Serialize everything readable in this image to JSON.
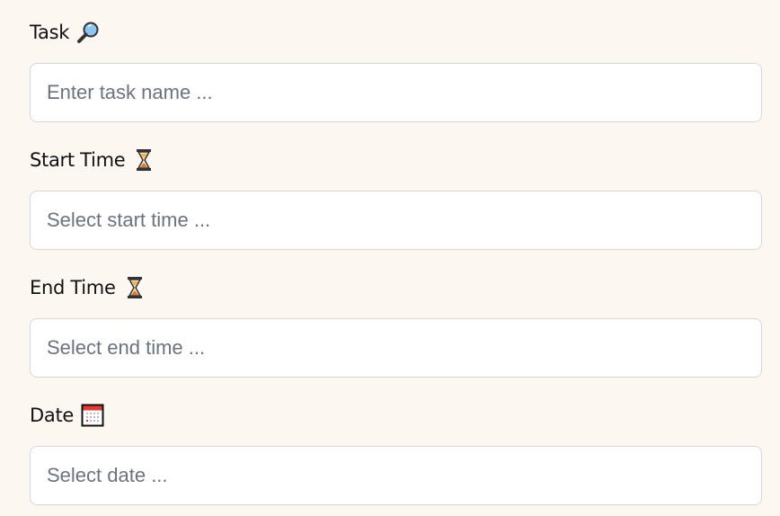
{
  "fields": [
    {
      "label": "Task",
      "icon": "magnifying-glass-icon",
      "placeholder": "Enter task name ..."
    },
    {
      "label": "Start Time",
      "icon": "hourglass-icon",
      "placeholder": "Select start time ..."
    },
    {
      "label": "End Time",
      "icon": "hourglass-icon",
      "placeholder": "Select end time ..."
    },
    {
      "label": "Date",
      "icon": "calendar-icon",
      "placeholder": "Select date ..."
    }
  ],
  "colors": {
    "background": "#fdf7f1",
    "placeholder": "#6b7280",
    "border": "#d4d7dd"
  }
}
